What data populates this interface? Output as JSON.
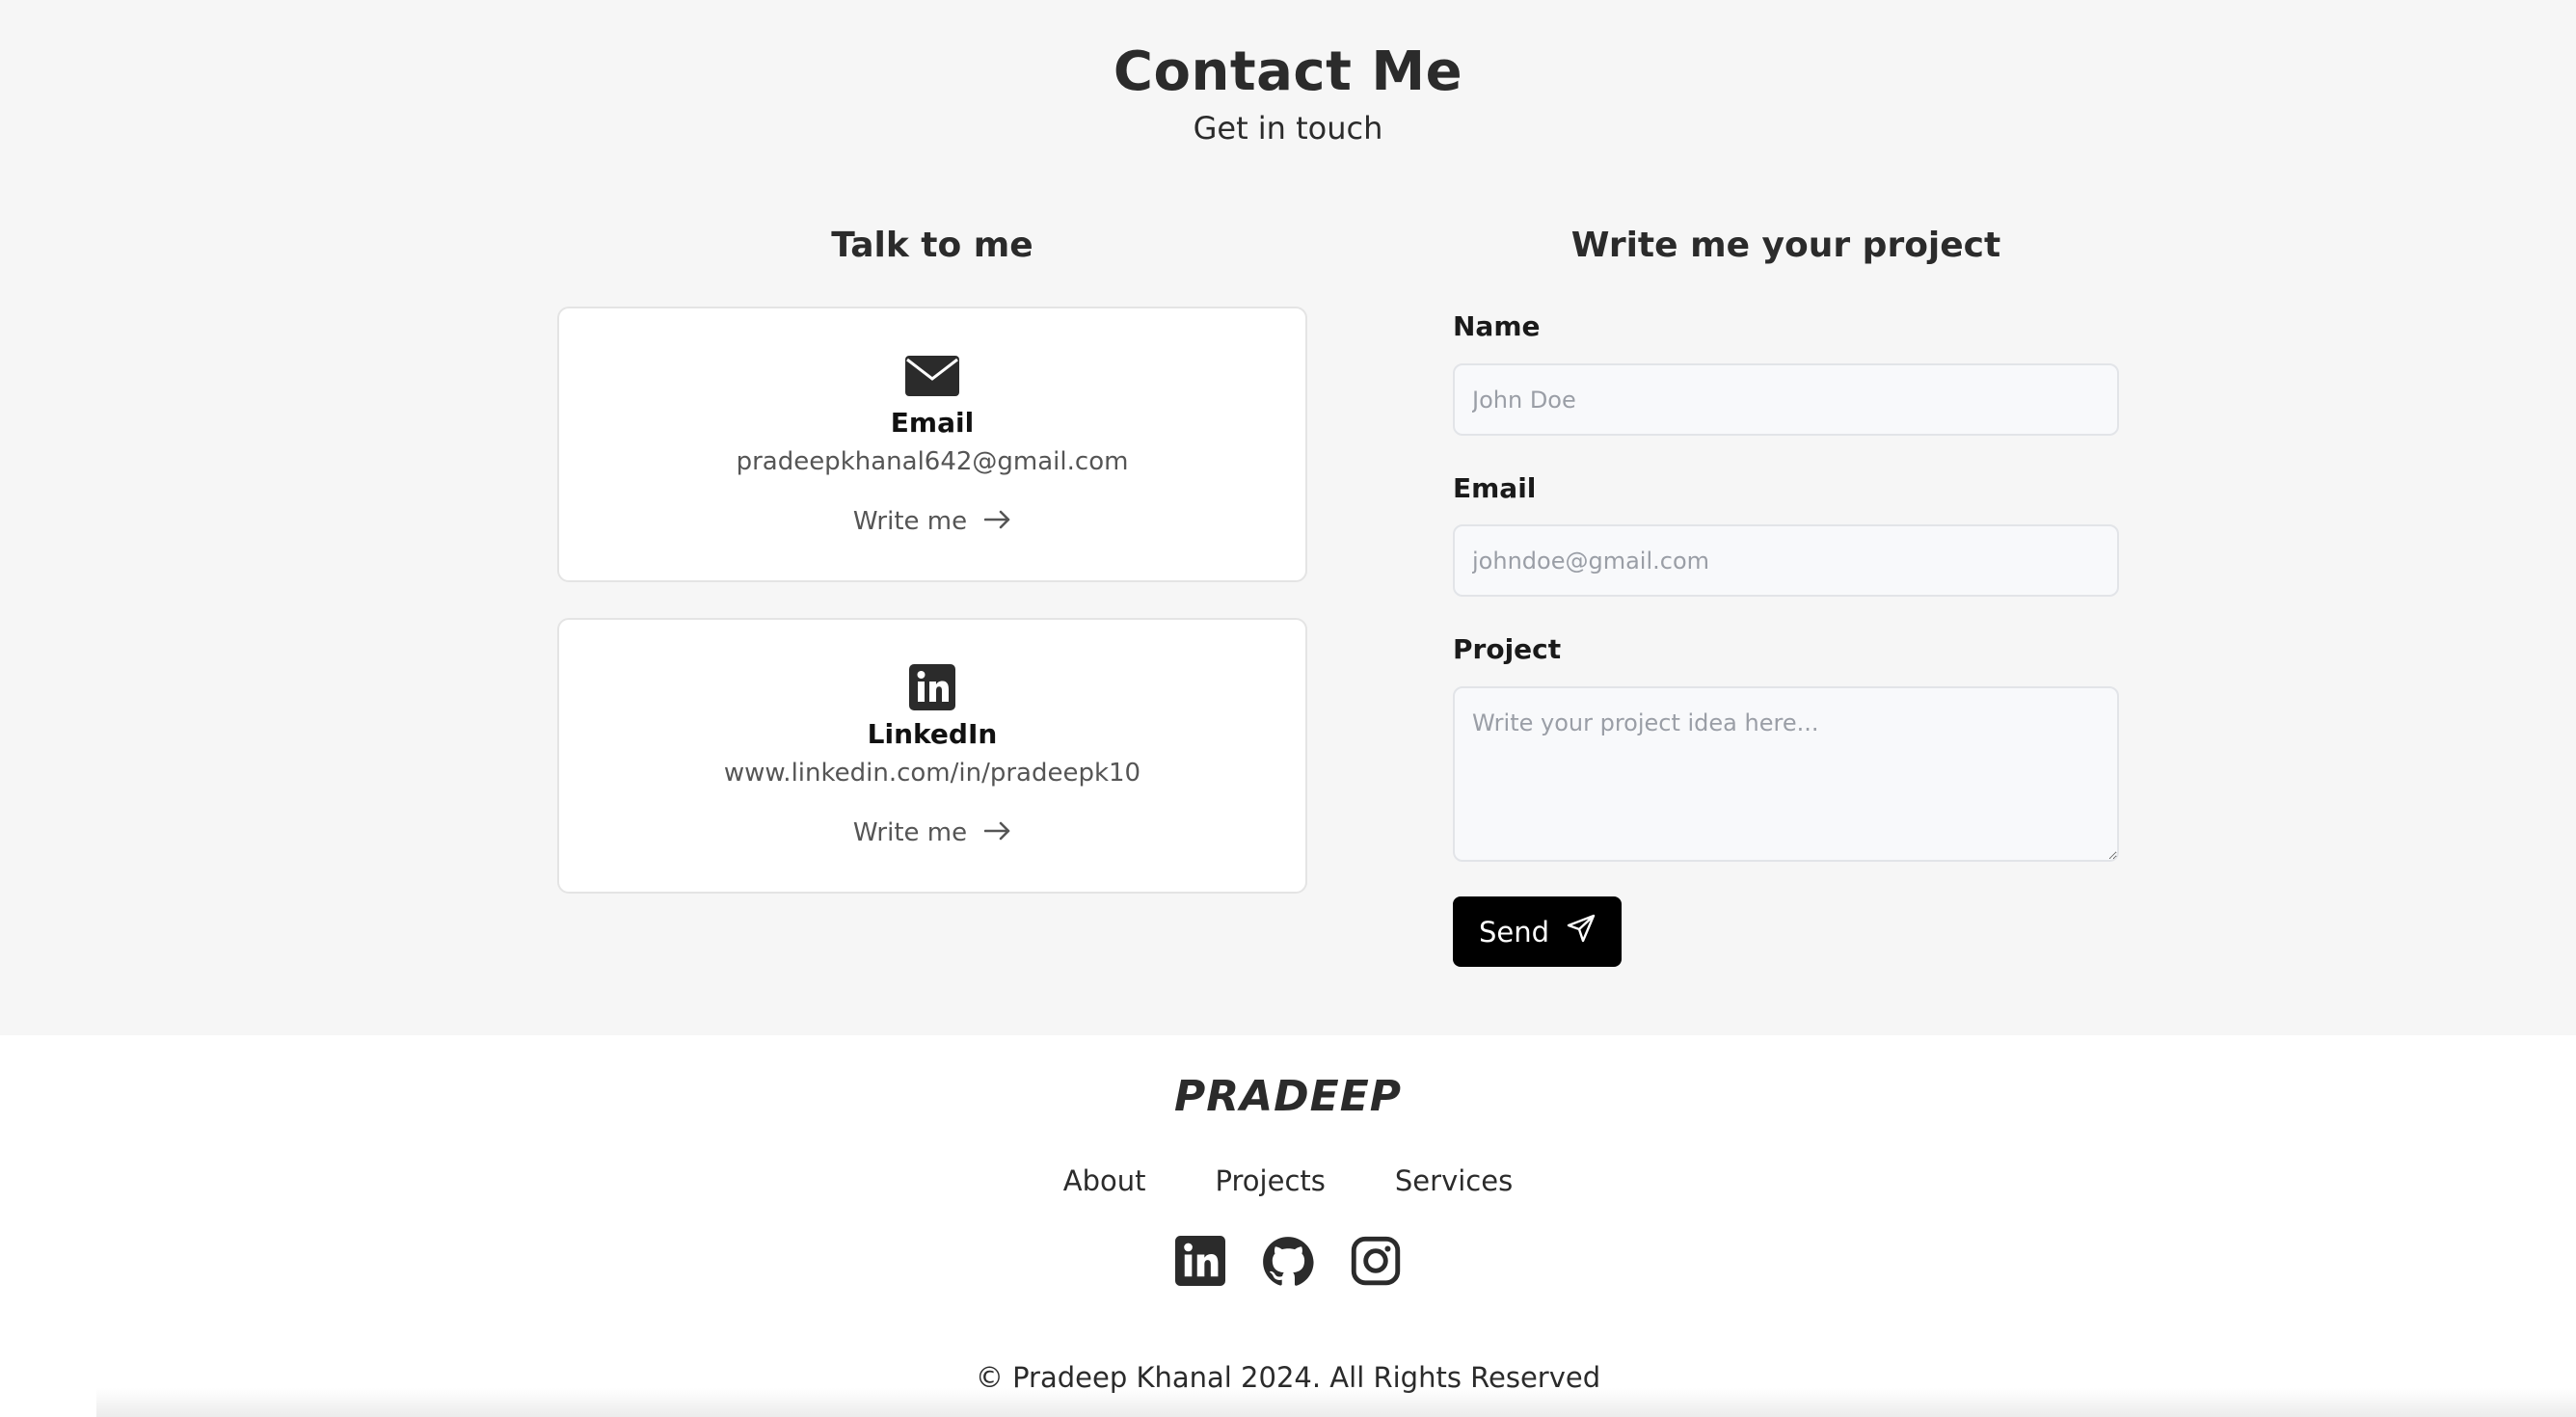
{
  "header": {
    "title": "Contact Me",
    "subtitle": "Get in touch"
  },
  "talk": {
    "title": "Talk to me",
    "cards": [
      {
        "icon": "envelope-icon",
        "label": "Email",
        "value": "pradeepkhanal642@gmail.com",
        "link_label": "Write me"
      },
      {
        "icon": "linkedin-icon",
        "label": "LinkedIn",
        "value": "www.linkedin.com/in/pradeepk10",
        "link_label": "Write me"
      }
    ]
  },
  "form": {
    "title": "Write me your project",
    "name_label": "Name",
    "name_placeholder": "John Doe",
    "email_label": "Email",
    "email_placeholder": "johndoe@gmail.com",
    "project_label": "Project",
    "project_placeholder": "Write your project idea here...",
    "send_label": "Send"
  },
  "footer": {
    "logo": "PRADEEP",
    "nav": [
      "About",
      "Projects",
      "Services"
    ],
    "social_icons": [
      "linkedin-icon",
      "github-icon",
      "instagram-icon"
    ],
    "copyright": "© Pradeep Khanal 2024. All Rights Reserved"
  },
  "colors": {
    "background": "#f6f6f6",
    "card": "#ffffff",
    "text": "#2b2b2b",
    "button": "#000000"
  }
}
